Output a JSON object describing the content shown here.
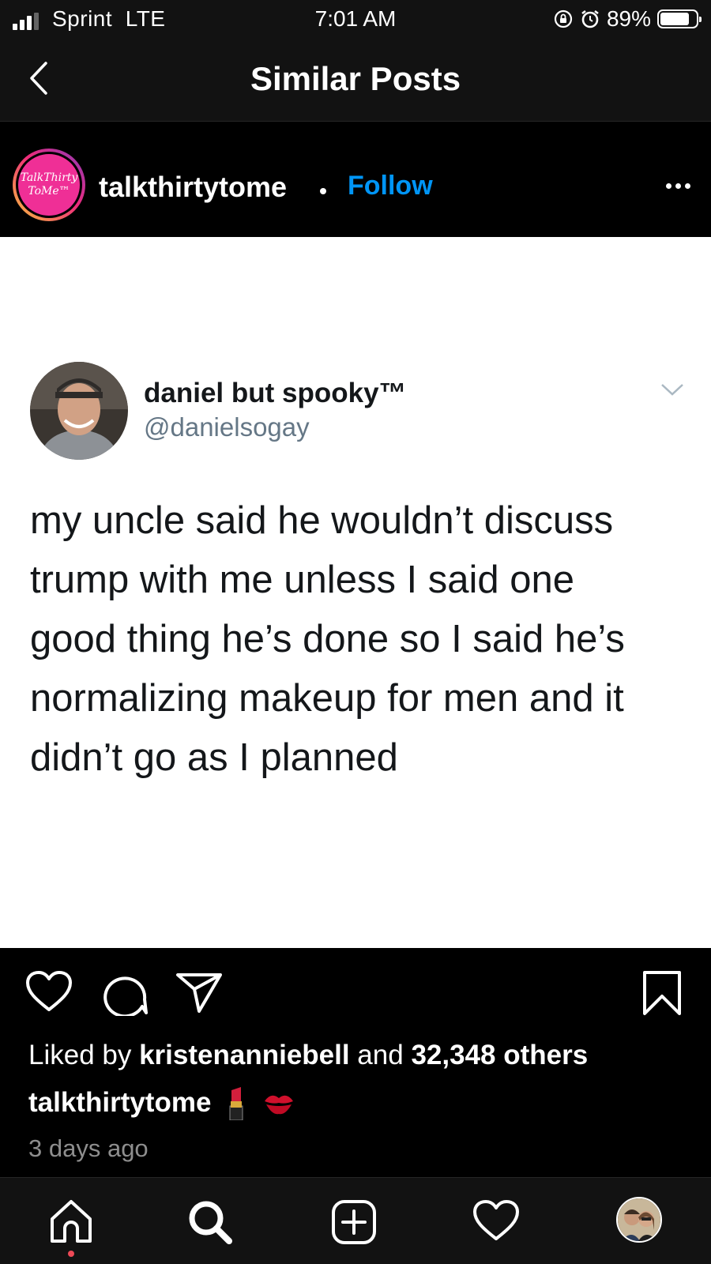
{
  "status_bar": {
    "carrier": "Sprint  LTE",
    "time": "7:01 AM",
    "battery_percent": "89%",
    "battery_level": 0.89,
    "signal_bars": 3
  },
  "nav": {
    "title": "Similar Posts",
    "back_icon": "chevron-left-icon"
  },
  "post": {
    "avatar_text_line1": "TalkThirty",
    "avatar_text_line2": "ToMe™",
    "username": "talkthirtytome",
    "follow_label": "Follow",
    "accent_color": "#0095f6"
  },
  "tweet": {
    "display_name": "daniel but spooky™",
    "handle": "@danielsogay",
    "lines": [
      "my uncle said he wouldn’t discuss",
      "trump with me unless I said one",
      "good thing he’s done so I said he’s",
      "normalizing makeup for men and it",
      "didn’t go as I planned"
    ]
  },
  "engagement": {
    "liked_by_prefix": "Liked by ",
    "liked_by_user": "kristenanniebell",
    "liked_by_middle": " and ",
    "liked_by_others": "32,348 others",
    "caption_user": "talkthirtytome",
    "caption_emojis": [
      "lipstick-icon",
      "kiss-mark-icon"
    ],
    "timestamp": "3 days ago"
  },
  "tabbar": {
    "items": [
      "home-icon",
      "search-icon",
      "new-post-icon",
      "activity-heart-icon",
      "profile-avatar"
    ]
  }
}
